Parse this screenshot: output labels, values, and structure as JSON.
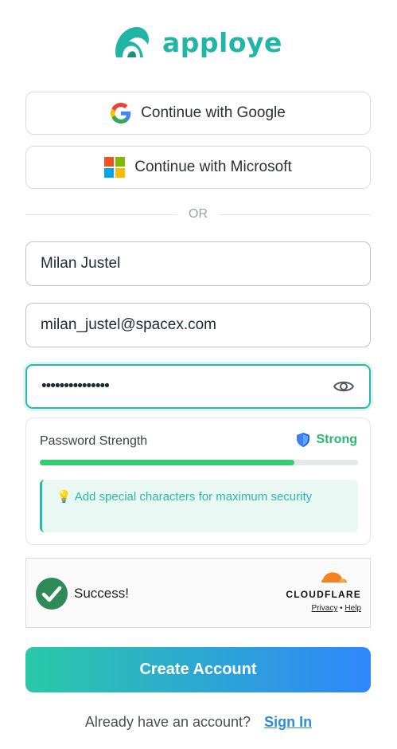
{
  "brand": {
    "name": "apploye",
    "color": "#21b5a6",
    "icon": "apploye-logo-icon"
  },
  "oauth": {
    "google_label": "Continue with Google",
    "microsoft_label": "Continue with Microsoft"
  },
  "divider": {
    "label": "OR"
  },
  "form": {
    "name_value": "Milan Justel",
    "email_value": "milan_justel@spacex.com",
    "password_masked": "•••••••••••••••",
    "password_icon": "eye-icon"
  },
  "strength": {
    "label": "Password Strength",
    "status": "Strong",
    "status_icon": "shield-icon",
    "level_fraction": 0.8,
    "tip": "Add special characters for maximum security",
    "tip_icon": "lightbulb-icon",
    "colors": {
      "status": "#2bb673",
      "bar": "#2fcf6b",
      "tip": "#2ab9a8"
    }
  },
  "captcha": {
    "status": "Success!",
    "provider": "CLOUDFLARE",
    "privacy_label": "Privacy",
    "separator": "•",
    "help_label": "Help"
  },
  "cta": {
    "label": "Create Account",
    "gradient": [
      "#2ac9a8",
      "#2f87fb"
    ]
  },
  "footer": {
    "prompt": "Already have an account?",
    "link_label": "Sign In"
  }
}
